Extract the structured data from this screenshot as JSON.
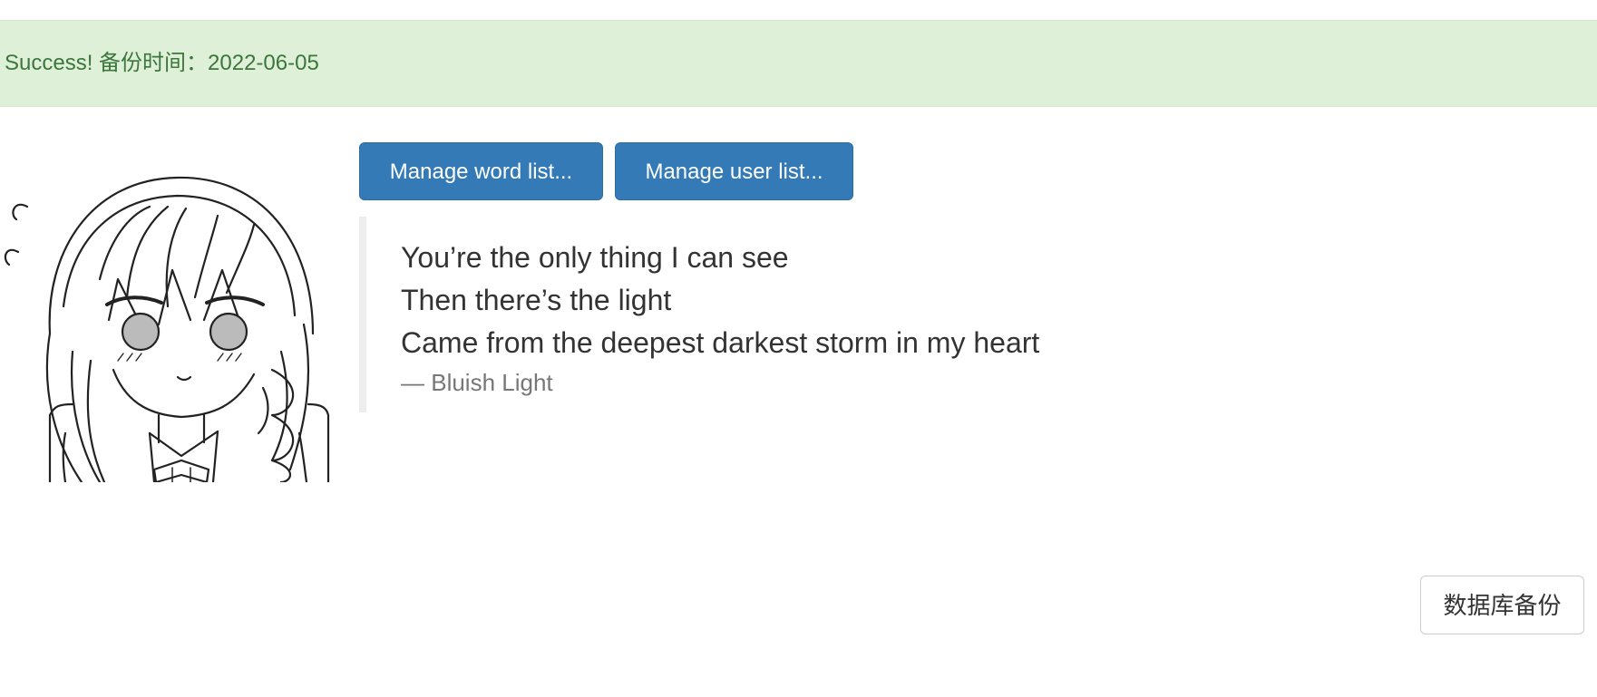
{
  "alert": {
    "prefix": "Success!",
    "message": "备份时间：2022-06-05",
    "color": "#3c763d",
    "background": "#dff0d8"
  },
  "avatar": {
    "icon": "anime-girl-avatar"
  },
  "toolbar": {
    "manage_word_label": "Manage word list...",
    "manage_user_label": "Manage user list...",
    "accent": "#337ab7"
  },
  "quote": {
    "lines": [
      "You’re the only thing I can see",
      "Then there’s the light",
      "Came from the deepest darkest storm in my heart"
    ],
    "source": "— Bluish Light"
  },
  "backup": {
    "label": "数据库备份"
  }
}
